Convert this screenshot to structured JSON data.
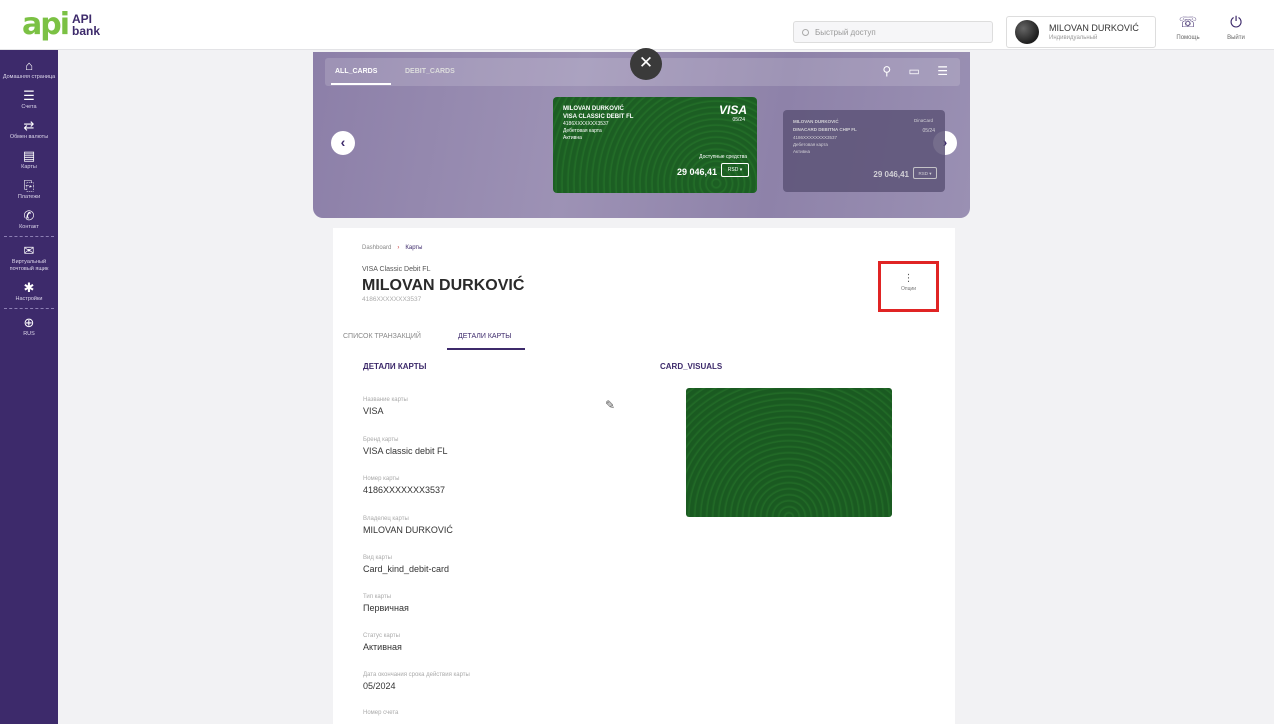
{
  "header": {
    "logo_mark": "api",
    "logo_line1": "API",
    "logo_line2": "bank",
    "search_placeholder": "Быстрый доступ",
    "user_name": "MILOVAN DURKOVIĆ",
    "user_role": "Индивидуальный",
    "help_label": "Помощь",
    "logout_label": "Выйти"
  },
  "sidebar": {
    "items": [
      {
        "label": "Домашняя страница",
        "icon": "home-icon"
      },
      {
        "label": "Счета",
        "icon": "list-icon"
      },
      {
        "label": "Обмен валюты",
        "icon": "exchange-icon"
      },
      {
        "label": "Карты",
        "icon": "cards-icon"
      },
      {
        "label": "Платежи",
        "icon": "payments-icon"
      },
      {
        "label": "Контакт",
        "icon": "contact-icon"
      },
      {
        "label": "Виртуальный почтовый ящик",
        "icon": "mail-icon"
      },
      {
        "label": "Настройки",
        "icon": "gear-icon"
      },
      {
        "label": "RUS",
        "icon": "globe-icon"
      }
    ]
  },
  "carousel": {
    "tab_all": "ALL_CARDS",
    "tab_debit": "DEBIT_CARDS",
    "main_card": {
      "holder": "MILOVAN DURKOVIĆ",
      "product": "VISA CLASSIC DEBIT FL",
      "number": "4186XXXXXXX3537",
      "kind": "Дебетовая карта",
      "status": "Активна",
      "brand": "VISA",
      "expiry": "05/24",
      "available_label": "Доступные средства",
      "balance": "29 046,41",
      "currency": "RSD"
    },
    "side_card": {
      "holder": "MILOVAN DURKOVIĆ",
      "product": "DINACARD DEBITNA CHIP FL",
      "number": "4186XXXXXXXX3537",
      "kind": "Дебетовая карта",
      "status": "Активна",
      "brand": "DinaCard",
      "expiry": "05/24",
      "available_label": "Доступные средства",
      "balance": "29 046,41",
      "currency": "RSD"
    }
  },
  "panel": {
    "breadcrumb": [
      "Dashboard",
      "Карты"
    ],
    "card_type": "VISA Classic Debit FL",
    "owner": "MILOVAN DURKOVIĆ",
    "card_number": "4186XXXXXXX3537",
    "options_label": "Опции",
    "tabs": [
      "СПИСОК ТРАНЗАКЦИЙ",
      "ДЕТАЛИ КАРТЫ"
    ],
    "details_title": "ДЕТАЛИ КАРТЫ",
    "visuals_title": "CARD_VISUALS",
    "fields": [
      {
        "label": "Название карты",
        "value": "VISA"
      },
      {
        "label": "Бренд карты",
        "value": "VISA classic debit FL"
      },
      {
        "label": "Номер карты",
        "value": "4186XXXXXXX3537"
      },
      {
        "label": "Владелец карты",
        "value": "MILOVAN DURKOVIĆ"
      },
      {
        "label": "Вид карты",
        "value": "Card_kind_debit-card"
      },
      {
        "label": "Тип карты",
        "value": "Первичная"
      },
      {
        "label": "Статус карты",
        "value": "Активная"
      },
      {
        "label": "Дата окончания срока действия карты",
        "value": "05/2024"
      },
      {
        "label": "Номер счета",
        "value": ""
      }
    ]
  },
  "colors": {
    "brand_purple": "#3d2a6b",
    "brand_green": "#7bc144",
    "card_green": "#1d5f24",
    "highlight_red": "#e02424"
  }
}
